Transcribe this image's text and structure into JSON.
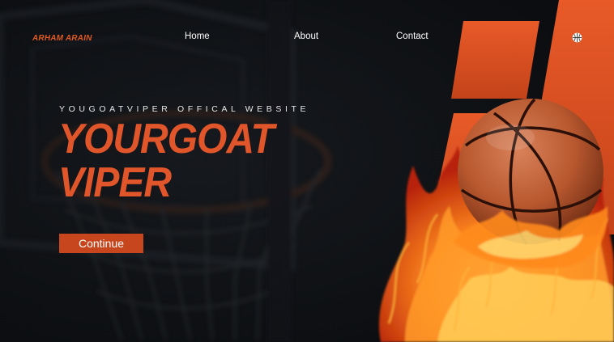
{
  "brand": {
    "logo_text": "ARHAM ARAIN"
  },
  "nav": {
    "items": [
      {
        "label": "Home"
      },
      {
        "label": "About"
      },
      {
        "label": "Contact"
      }
    ]
  },
  "hero": {
    "subtitle": "YOUGOATVIPER OFFICAL WEBSITE",
    "title_line1": "YOURGOAT",
    "title_line2": "VIPER",
    "cta_label": "Continue"
  },
  "icons": {
    "top_right": "basketball-icon"
  },
  "colors": {
    "accent": "#e0552a",
    "button": "#c8461e",
    "background": "#0d0f12",
    "nav_text": "#ffffff"
  }
}
